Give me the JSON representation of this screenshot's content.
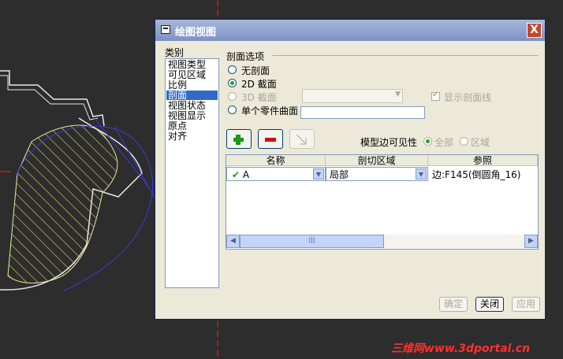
{
  "dialog": {
    "title": "绘图视图",
    "close_label": "X",
    "category_label": "类别",
    "categories": [
      "视图类型",
      "可见区域",
      "比例",
      "剖面",
      "视图状态",
      "视图显示",
      "原点",
      "对齐"
    ],
    "selected_category": "剖面"
  },
  "section_options": {
    "title": "剖面选项",
    "options": [
      "无剖面",
      "2D 截面",
      "3D 截面",
      "单个零件曲面"
    ],
    "selected": "2D 截面",
    "show_hatch_label": "显示剖面线",
    "surface_input_value": ""
  },
  "toolbar": {
    "add_icon": "plus-icon",
    "remove_icon": "minus-icon",
    "edit_icon": "arrow-icon",
    "model_edge_label": "模型边可见性",
    "visibility_options": [
      "全部",
      "区域"
    ],
    "visibility_selected": "全部"
  },
  "table": {
    "headers": [
      "名称",
      "剖切区域",
      "参照"
    ],
    "rows": [
      {
        "name": "A",
        "region": "局部",
        "reference": "边:F145(倒圆角_16)"
      }
    ]
  },
  "buttons": {
    "ok": "确定",
    "close": "关闭",
    "apply": "应用"
  },
  "watermark": "三维网www.3dportal.cn",
  "colors": {
    "selection": "#316ac5",
    "add_icon": "#1a9a1a",
    "remove_icon": "#cc1111",
    "hatch": "#e8e84a",
    "curve": "#3a3ad8"
  }
}
